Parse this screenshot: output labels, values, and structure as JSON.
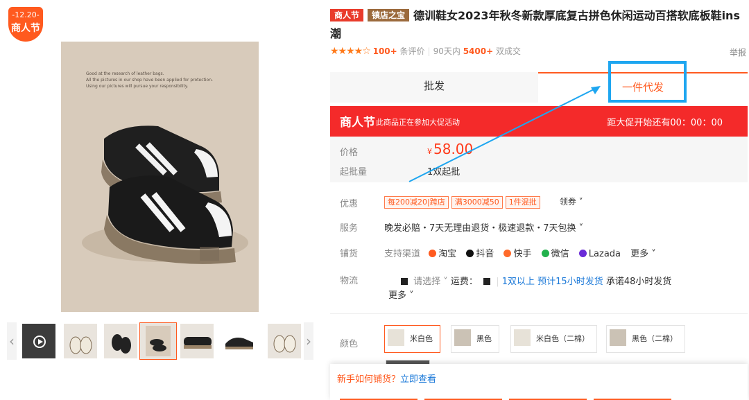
{
  "festival": {
    "date": "-12.20-",
    "name": "商人节"
  },
  "image": {
    "caption": [
      "Good at the research of leather bags.",
      "All the pictures in our shop have been applied for protection.",
      "Using our pictures will pursue your responsibility."
    ]
  },
  "thumbnails": {
    "prev": "‹",
    "next": "›"
  },
  "product": {
    "tag_festival": "商人节",
    "tag_shop": "镇店之宝",
    "title": "德训鞋女2023年秋冬新款厚底复古拼色休闲运动百搭软底板鞋ins潮"
  },
  "rating": {
    "stars": "★★★★☆",
    "review_count": "100+",
    "review_label": "条评价",
    "period": "90天内",
    "sales": "5400+",
    "sales_label": "双成交",
    "report": "举报"
  },
  "tabs": {
    "wholesale": "批发",
    "dropship": "一件代发"
  },
  "promo": {
    "name": "商人节",
    "desc": "此商品正在参加大促活动",
    "countdown": "距大促开始还有00：00：00"
  },
  "price": {
    "label": "价格",
    "currency": "¥",
    "value": "58.00",
    "moq_label": "起批量",
    "moq": "1双起批"
  },
  "offers": {
    "label": "优惠",
    "coupons": [
      "每200减20|跨店",
      "满3000减50",
      "1件混批"
    ],
    "get": "领券 ˅"
  },
  "service": {
    "label": "服务",
    "value": "晚发必赔・7天无理由退货・极速退款・7天包换 ˅"
  },
  "channels": {
    "label": "铺货",
    "intro": "支持渠道",
    "items": [
      {
        "name": "淘宝",
        "color": "#ff5a1f"
      },
      {
        "name": "抖音",
        "color": "#111111"
      },
      {
        "name": "快手",
        "color": "#ff6a2a"
      },
      {
        "name": "微信",
        "color": "#22b14c"
      },
      {
        "name": "Lazada",
        "color": "#6a2bd8"
      }
    ],
    "more": "更多 ˅"
  },
  "logistics": {
    "label": "物流",
    "select": "请选择 ˅",
    "fee_label": "运费：",
    "ship_promise": "1双以上 预计15小时发货",
    "commit": "承诺48小时发货",
    "more": "更多 ˅"
  },
  "colors": {
    "label": "颜色",
    "options": [
      "米白色",
      "黑色",
      "米白色（二棉）",
      "黑色（二棉）"
    ]
  },
  "help": {
    "question": "新手如何铺货？",
    "link": "立即查看"
  }
}
